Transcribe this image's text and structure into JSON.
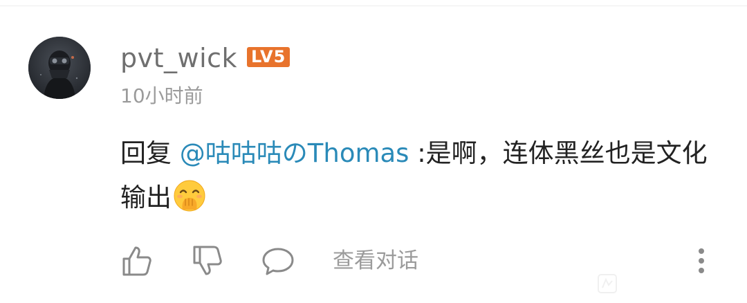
{
  "comment": {
    "author": {
      "username": "pvt_wick",
      "level_badge": "LV5",
      "avatar_icon": "avatar-image"
    },
    "timestamp": "10小时前",
    "reply_prefix": "回复",
    "mention": "@咕咕咕のThomas",
    "body_text": " :是啊，连体黑丝也是文化输出",
    "emoji": "hand-over-mouth-emoji"
  },
  "actions": {
    "like_icon": "thumbs-up-icon",
    "dislike_icon": "thumbs-down-icon",
    "comment_icon": "speech-bubble-icon",
    "view_conversation_label": "查看对话",
    "more_icon": "more-vertical-icon"
  },
  "colors": {
    "badge": "#e8732c",
    "mention": "#2a8ab8",
    "text": "#222222",
    "muted": "#9b9b9b"
  }
}
